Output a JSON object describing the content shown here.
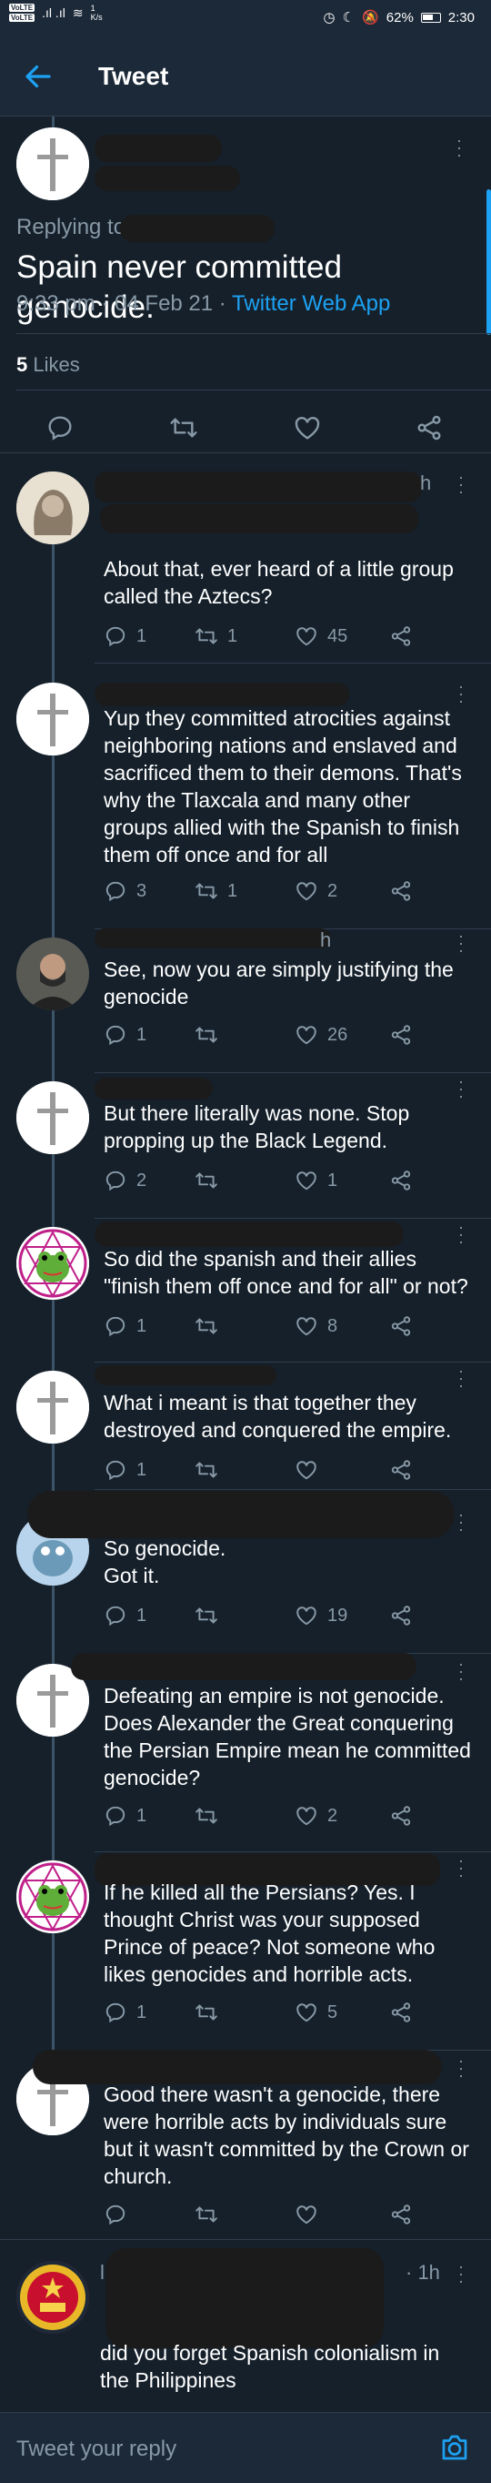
{
  "status_bar": {
    "speed": "1\nK/s",
    "battery": "62%",
    "time": "2:30"
  },
  "header": {
    "title": "Tweet"
  },
  "main_tweet": {
    "replying_to": "Replying to",
    "text": "Spain never committed genocide.",
    "time": "9:33 pm · 04 Feb 21 · ",
    "source": "Twitter Web App",
    "likes_count": "5",
    "likes_label": " Likes"
  },
  "replies": [
    {
      "time": "h",
      "text": "About that, ever heard of a little group called the Aztecs?",
      "replies": "1",
      "retweets": "1",
      "likes": "45"
    },
    {
      "text": "Yup they committed atrocities against neighboring nations and enslaved and sacrificed them to their demons. That's why the Tlaxcala and many other groups allied with the Spanish to finish them off once and for all",
      "replies": "3",
      "retweets": "1",
      "likes": "2"
    },
    {
      "time": "h",
      "text": "See, now you are simply justifying the genocide",
      "replies": "1",
      "retweets": "",
      "likes": "26"
    },
    {
      "text": "But there literally was none. Stop propping up the Black Legend.",
      "replies": "2",
      "retweets": "",
      "likes": "1"
    },
    {
      "text": "So did the spanish and their allies \"finish them off once and for all\" or not?",
      "replies": "1",
      "retweets": "",
      "likes": "8"
    },
    {
      "text": "What i meant is that together they destroyed and conquered the empire.",
      "replies": "1",
      "retweets": "",
      "likes": ""
    },
    {
      "text": "So genocide.\nGot it.",
      "replies": "1",
      "retweets": "",
      "likes": "19"
    },
    {
      "text": "Defeating an empire is not genocide. Does Alexander the Great conquering the Persian Empire mean he committed genocide?",
      "replies": "1",
      "retweets": "",
      "likes": "2"
    },
    {
      "text": "If he killed all the Persians? Yes. I thought Christ was your supposed Prince of peace? Not someone who likes genocides and horrible acts.",
      "replies": "1",
      "retweets": "",
      "likes": "5"
    },
    {
      "text": "Good there wasn't a genocide, there were horrible acts by individuals sure but it wasn't committed by the Crown or church.",
      "replies": "",
      "retweets": "",
      "likes": ""
    },
    {
      "time": "· 1h",
      "handle_initial": "l",
      "text": "did you forget Spanish colonialism in the Philippines"
    }
  ],
  "compose": {
    "placeholder": "Tweet your reply"
  },
  "colors": {
    "background": "#15202b",
    "accent": "#1da1f2",
    "secondary": "#8899a6",
    "divider": "#2f3d4c"
  },
  "icons": [
    "back-arrow-icon",
    "more-icon",
    "reply-icon",
    "retweet-icon",
    "like-icon",
    "share-icon",
    "camera-icon"
  ]
}
